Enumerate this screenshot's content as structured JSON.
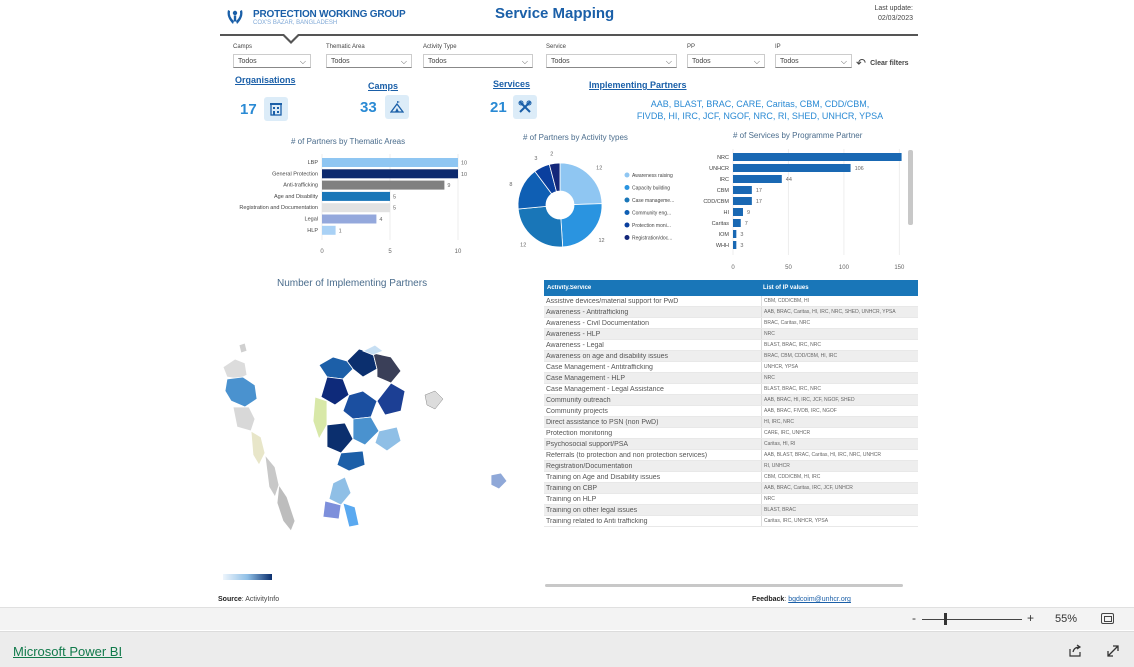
{
  "header": {
    "org_name": "PROTECTION WORKING GROUP",
    "org_sub": "COX'S BAZAR, BANGLADESH",
    "title": "Service Mapping",
    "last_update_label": "Last update:",
    "last_update_value": "02/03/2023"
  },
  "filters": [
    {
      "label": "Camps",
      "value": "Todos"
    },
    {
      "label": "Thematic Area",
      "value": "Todos"
    },
    {
      "label": "Activity Type",
      "value": "Todos"
    },
    {
      "label": "Service",
      "value": "Todos"
    },
    {
      "label": "PP",
      "value": "Todos"
    },
    {
      "label": "IP",
      "value": "Todos"
    }
  ],
  "clear_filters_label": "Clear filters",
  "kpis": {
    "organisations": {
      "label": "Organisations",
      "value": "17"
    },
    "camps": {
      "label": "Camps",
      "value": "33"
    },
    "services": {
      "label": "Services",
      "value": "21"
    }
  },
  "implementing_partners": {
    "label": "Implementing Partners",
    "list_line1": "AAB, BLAST, BRAC, CARE, Caritas, CBM, CDD/CBM,",
    "list_line2": "FIVDB, HI, IRC, JCF, NGOF, NRC, RI, SHED, UNHCR, YPSA"
  },
  "chart_data": [
    {
      "type": "bar",
      "title": "# of Partners by Thematic Areas",
      "categories": [
        "LBP",
        "General Protection",
        "Anti-trafficking",
        "Age and Disability",
        "Registration and Documentation",
        "Legal",
        "HLP"
      ],
      "values": [
        10,
        10,
        9,
        5,
        5,
        4,
        1
      ],
      "colors": [
        "#8fc6f2",
        "#0d2a6e",
        "#808080",
        "#1976b8",
        "#e2e2e2",
        "#94a8dc",
        "#a9d1f5"
      ],
      "xticks": [
        "0",
        "5",
        "10"
      ],
      "xlim": [
        0,
        10
      ]
    },
    {
      "type": "pie",
      "title": "# of Partners by Activity types",
      "categories": [
        "Awareness raising",
        "Capacity building",
        "Case manageme...",
        "Community eng...",
        "Protection moni...",
        "Registration/doc..."
      ],
      "values": [
        12,
        12,
        12,
        8,
        3,
        2
      ],
      "colors": [
        "#8fc6f2",
        "#2a94e0",
        "#1976b8",
        "#0f5fb4",
        "#0a3f9e",
        "#13277a"
      ]
    },
    {
      "type": "bar",
      "title": "# of Services by Programme Partner",
      "categories": [
        "NRC",
        "UNHCR",
        "IRC",
        "CBM",
        "CDD/CBM",
        "HI",
        "Caritas",
        "IOM",
        "WHH"
      ],
      "values": [
        152,
        106,
        44,
        17,
        17,
        9,
        7,
        3,
        3
      ],
      "color": "#1968b3",
      "xticks": [
        "0",
        "50",
        "100",
        "150"
      ],
      "xlim": [
        0,
        165
      ]
    }
  ],
  "map": {
    "title": "Number of Implementing Partners",
    "legend_colors": [
      "#eef5fc",
      "#c7dff3",
      "#8fbfe6",
      "#4a92cf",
      "#1c5fa8",
      "#0b2f6e"
    ]
  },
  "table": {
    "headers": [
      "Activity.Service",
      "List of IP values"
    ],
    "rows": [
      [
        "Assistive devices/material support for PwD",
        "CBM, CDD/CBM, HI"
      ],
      [
        "Awareness - Antitrafficking",
        "AAB, BRAC, Caritas, HI, IRC, NRC, SHED, UNHCR, YPSA"
      ],
      [
        "Awareness - Civil Documentation",
        "BRAC, Caritas, NRC"
      ],
      [
        "Awareness - HLP",
        "NRC"
      ],
      [
        "Awareness - Legal",
        "BLAST, BRAC, IRC, NRC"
      ],
      [
        "Awareness on age and disability issues",
        "BRAC, CBM, CDD/CBM, HI, IRC"
      ],
      [
        "Case Management - Antitrafficking",
        "UNHCR, YPSA"
      ],
      [
        "Case Management - HLP",
        "NRC"
      ],
      [
        "Case Management - Legal Assistance",
        "BLAST, BRAC, IRC, NRC"
      ],
      [
        "Community outreach",
        "AAB, BRAC, HI, IRC, JCF, NGOF, SHED"
      ],
      [
        "Community projects",
        "AAB, BRAC, FIVDB, IRC, NGOF"
      ],
      [
        "Direct assistance to PSN (non PwD)",
        "HI, IRC, NRC"
      ],
      [
        "Protection monitoring",
        "CARE, IRC, UNHCR"
      ],
      [
        "Psychosocial support/PSA",
        "Caritas, HI, RI"
      ],
      [
        "Referrals (to protection and non protection services)",
        "AAB, BLAST, BRAC, Caritas, HI, IRC, NRC, UNHCR"
      ],
      [
        "Registration/Documentation",
        "RI, UNHCR"
      ],
      [
        "Training on Age and Disability issues",
        "CBM, CDD/CBM, HI, IRC"
      ],
      [
        "Training on CBP",
        "AAB, BRAC, Caritas, IRC, JCF, UNHCR"
      ],
      [
        "Training on HLP",
        "NRC"
      ],
      [
        "Training on other legal issues",
        "BLAST, BRAC"
      ],
      [
        "Training related to Anti trafficking",
        "Caritas, IRC, UNHCR, YPSA"
      ]
    ]
  },
  "footer_notes": {
    "source_label": "Source",
    "source_value": ": ActivityInfo",
    "feedback_label": "Feedback",
    "feedback_value": "bgdcoim@unhcr.org"
  },
  "zoom": {
    "minus": "-",
    "plus": "+",
    "value": "55%"
  },
  "brand": "Microsoft Power BI"
}
